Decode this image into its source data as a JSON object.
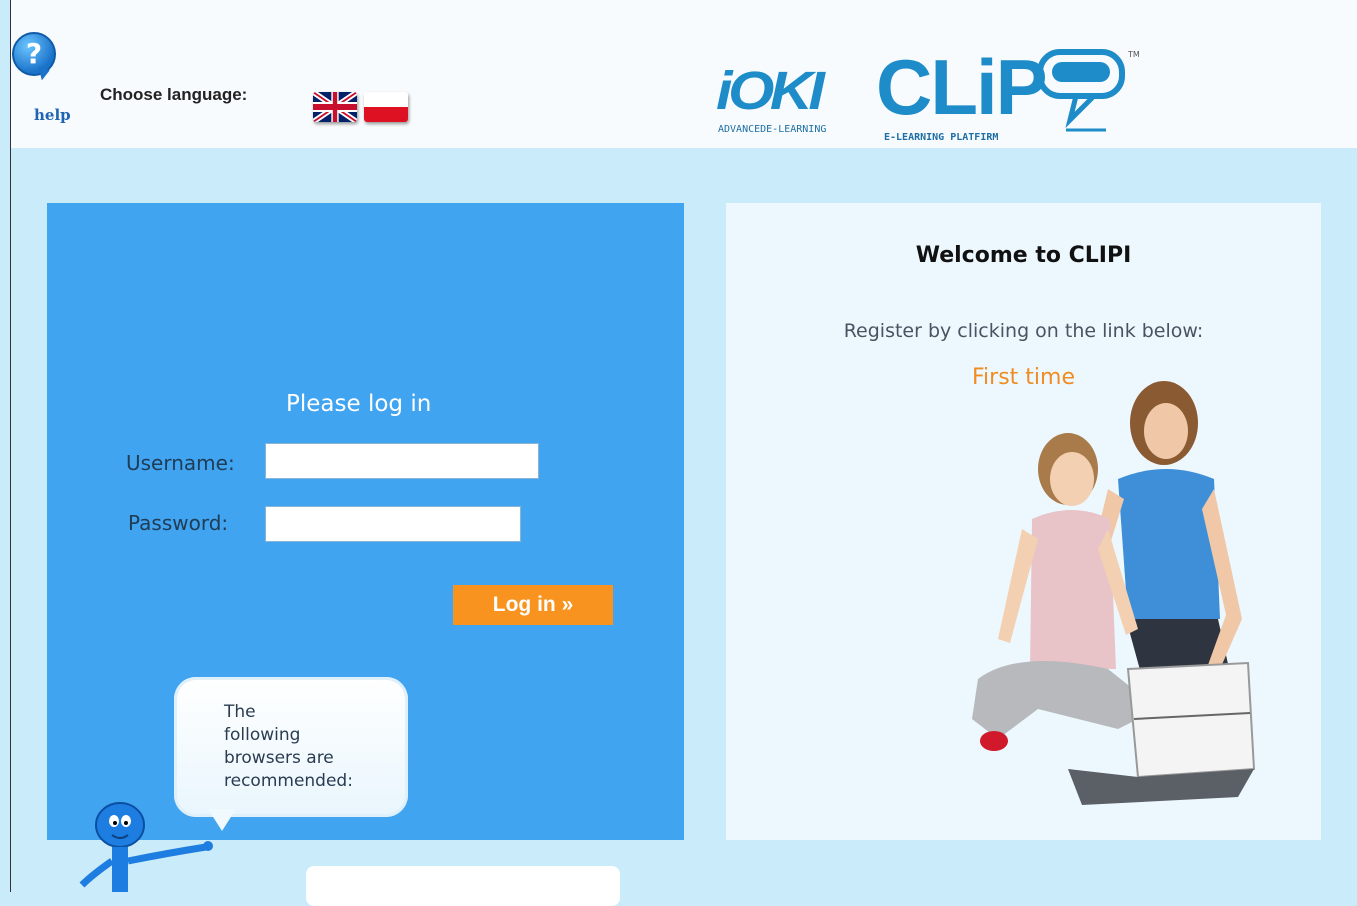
{
  "header": {
    "help_label": "help",
    "choose_language_label": "Choose language:",
    "languages": [
      "English",
      "Polski"
    ],
    "logo": {
      "brand": "iOKI",
      "brand_tagline": "ADVANCEDE-LEARNING",
      "product": "CLiP",
      "product_tagline": "E-LEARNING PLATFIRM",
      "trademark": "TM"
    }
  },
  "login": {
    "title": "Please log in",
    "username_label": "Username:",
    "password_label": "Password:",
    "username_value": "",
    "password_value": "",
    "submit_label": "Log in »",
    "bubble_text": "The following browsers are recommended:"
  },
  "welcome": {
    "heading": "Welcome to CLIPI",
    "register_text": "Register by clicking on the link below:",
    "first_time_link": "First time"
  },
  "colors": {
    "login_panel": "#40a4f1",
    "welcome_panel": "#edf8fe",
    "page_background": "#c9ebfa",
    "accent_orange": "#f7931e",
    "brand_blue": "#1d8cc9"
  }
}
